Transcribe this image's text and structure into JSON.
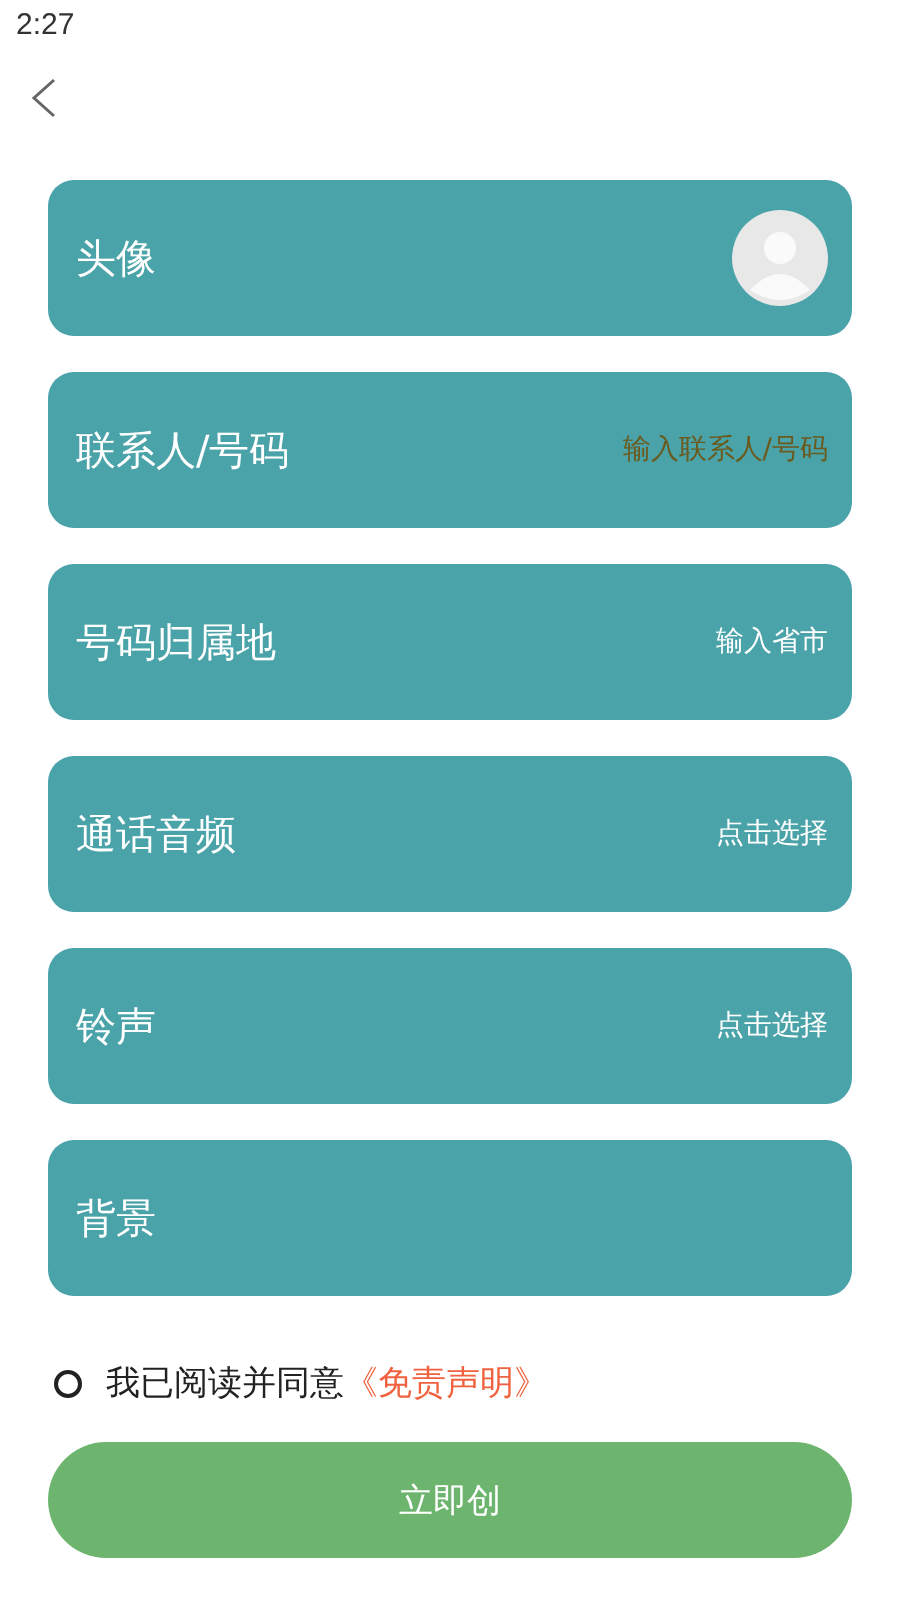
{
  "status_bar": {
    "time": "2:27"
  },
  "rows": [
    {
      "kind": "avatar",
      "label": "头像"
    },
    {
      "kind": "text",
      "label": "联系人/号码",
      "value": "输入联系人/号码",
      "color": "#6b5a1e"
    },
    {
      "kind": "text",
      "label": "号码归属地",
      "value": "输入省市",
      "color": "#ffffff"
    },
    {
      "kind": "text",
      "label": "通话音频",
      "value": "点击选择",
      "color": "#ffffff"
    },
    {
      "kind": "text",
      "label": "铃声",
      "value": "点击选择",
      "color": "#ffffff"
    },
    {
      "kind": "text",
      "label": "背景"
    }
  ],
  "agreement": {
    "checked": false,
    "text": "我已阅读并同意",
    "link": "《免责声明》"
  },
  "create_button": "立即创"
}
